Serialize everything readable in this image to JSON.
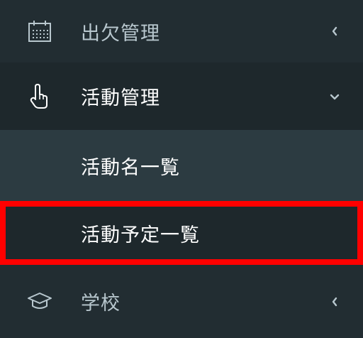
{
  "sidebar": {
    "items": [
      {
        "label": "出欠管理",
        "icon": "calendar-icon",
        "chevron": "chevron-left-icon"
      },
      {
        "label": "活動管理",
        "icon": "hand-pointer-icon",
        "chevron": "chevron-down-icon"
      },
      {
        "label": "学校",
        "icon": "graduation-cap-icon",
        "chevron": "chevron-left-icon"
      }
    ],
    "submenu": [
      {
        "label": "活動名一覧"
      },
      {
        "label": "活動予定一覧"
      }
    ]
  },
  "colors": {
    "sidebar_bg": "#222d32",
    "active_bg": "#1e282c",
    "submenu_bg": "#2c3b41",
    "text_muted": "#b8c7ce",
    "text_active": "#ffffff",
    "highlight": "#ff0000"
  }
}
